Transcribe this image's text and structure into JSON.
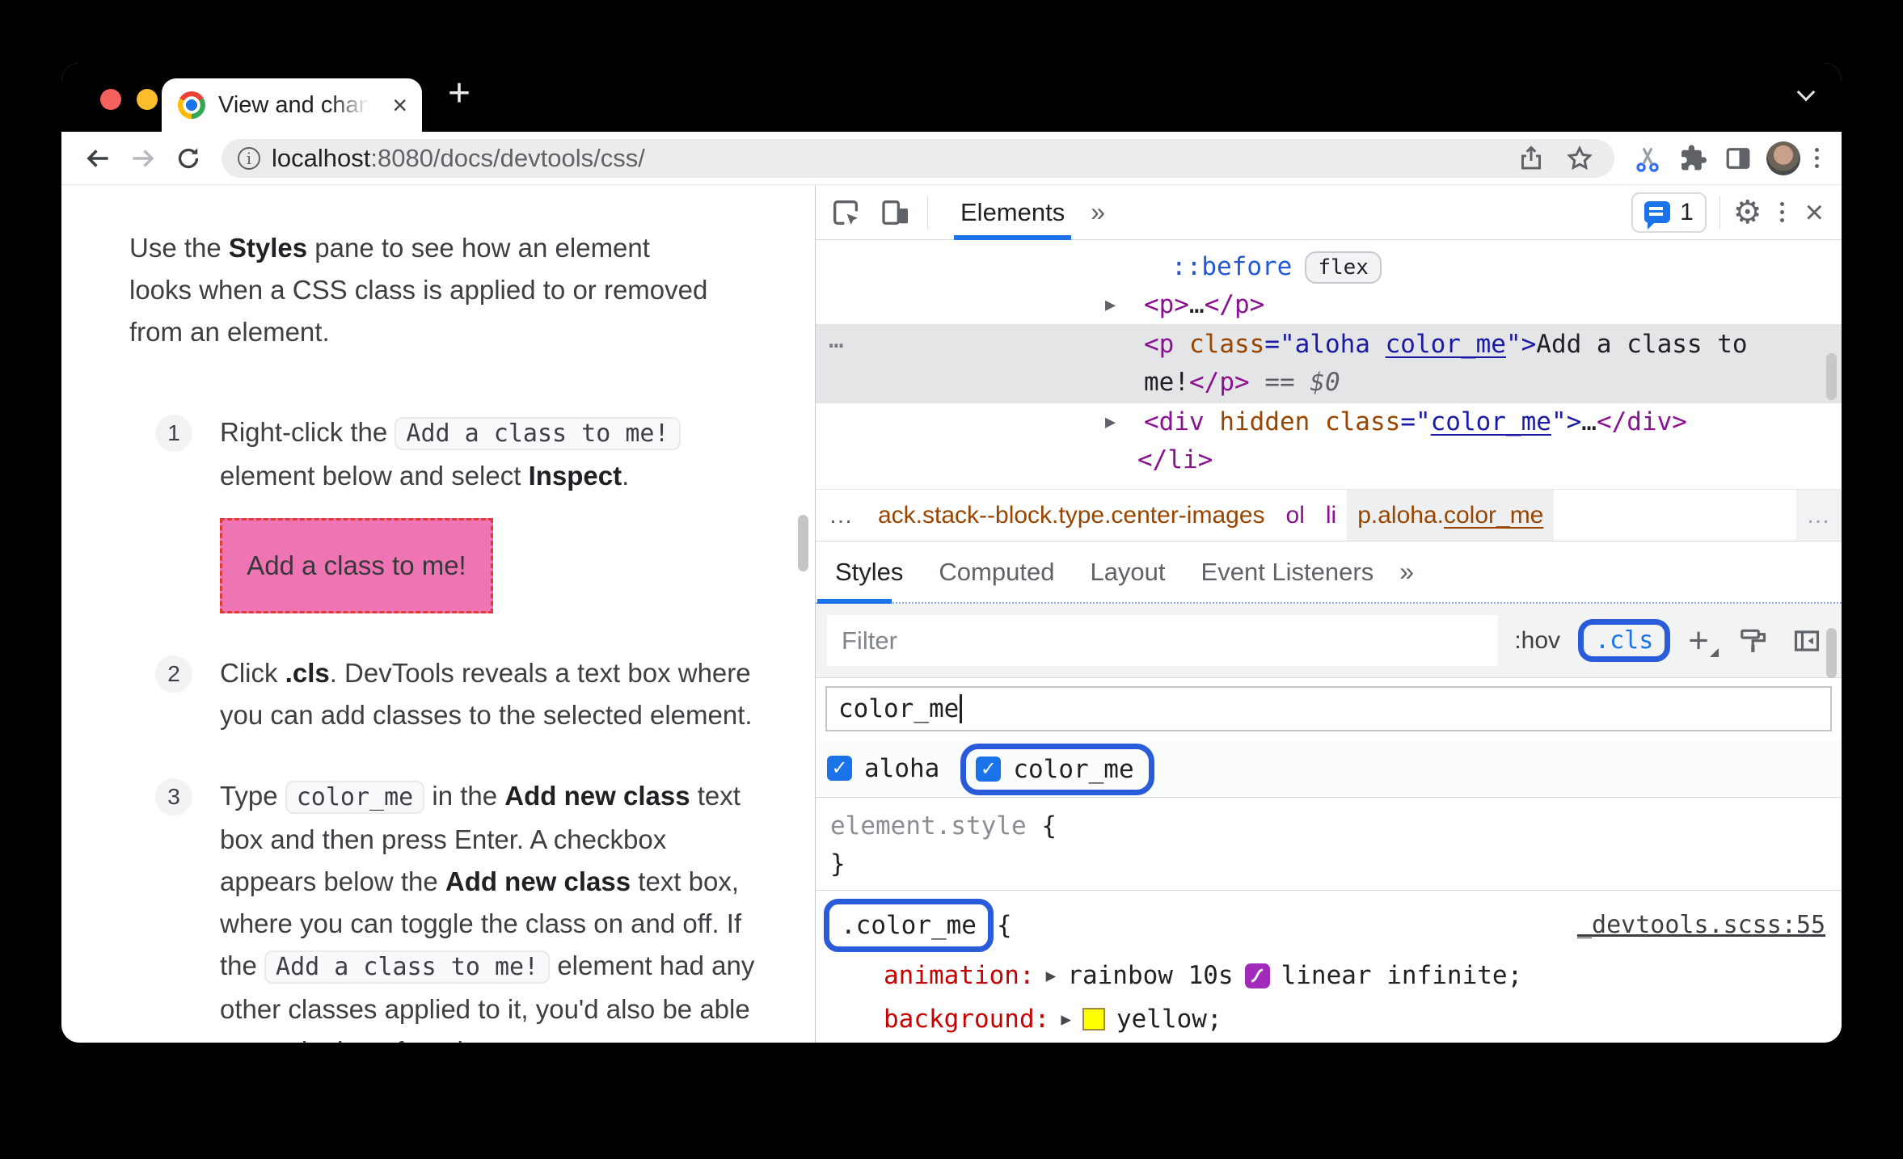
{
  "browser": {
    "tab": {
      "title": "View and change CSS - Chrome",
      "close": "×"
    },
    "new_tab": "+",
    "toolbar": {
      "url_host": "localhost",
      "url_path": ":8080/docs/devtools/css/"
    }
  },
  "doc": {
    "intro": {
      "a": "Use the ",
      "bold": "Styles",
      "b": " pane to see how an element looks when a CSS class is applied to or removed from an element."
    },
    "step1": {
      "num": "1",
      "a": "Right-click the ",
      "code": "Add a class to me!",
      "b": " element below and select ",
      "bold": "Inspect",
      "c": "."
    },
    "demo_box_text": "Add a class to me!",
    "step2": {
      "num": "2",
      "a": "Click ",
      "bold": ".cls",
      "b": ". DevTools reveals a text box where you can add classes to the selected element."
    },
    "step3": {
      "num": "3",
      "a": "Type ",
      "code": "color_me",
      "b": " in the ",
      "bold1": "Add new class",
      "c": " text box and then press Enter. A checkbox appears below the ",
      "bold2": "Add new class",
      "d": " text box, where you can toggle the class on and off. If the ",
      "code2": "Add a class to me!",
      "e": " element had any other classes applied to it, you'd also be able to toggle them from here."
    }
  },
  "devtools": {
    "toolbar": {
      "tab": "Elements",
      "more": "»",
      "issues_count": "1",
      "close": "×",
      "gear": "⚙"
    },
    "dom": {
      "pseudo": "::before",
      "flex_badge": "flex",
      "arrow": "▶",
      "p_row": {
        "open": "<p>",
        "dots": "…",
        "close": "</p>"
      },
      "selected_row": {
        "marker": "…",
        "tag_open": "<p ",
        "attr_name": "class",
        "eq": "=\"",
        "val_a": "aloha ",
        "val_b": "color_me",
        "close_quote": "\">",
        "text": "Add a class to me!",
        "tag_close": "</p>",
        "equals": " == ",
        "last_selected": "$0"
      },
      "div_row": {
        "tag_open": "<div ",
        "attr1": "hidden ",
        "attr2": "class",
        "eq": "=\"",
        "val": "color_me",
        "close_quote": "\">",
        "dots": "…",
        "tag_close": "</div>"
      },
      "li_close": "</li>"
    },
    "breadcrumbs": {
      "overflow_left": "…",
      "crumb_stack": "ack.stack--block.type.center-images",
      "crumb_ol": "ol",
      "crumb_li": "li",
      "crumb_p_a": "p.aloha.",
      "crumb_p_b": "color_me",
      "overflow_right": "…"
    },
    "styles_pane": {
      "tabs": [
        "Styles",
        "Computed",
        "Layout",
        "Event Listeners"
      ],
      "tabs_more": "»",
      "filter_placeholder": "Filter",
      "hov_toggle": ":hov",
      "cls_toggle": ".cls",
      "new_class_value": "color_me",
      "checkboxes": [
        {
          "label": "aloha",
          "check": "✓"
        },
        {
          "label": "color_me",
          "check": "✓"
        }
      ],
      "element_style": {
        "selector": "element.style",
        "open": "{",
        "close": "}"
      },
      "rule": {
        "selector": ".color_me",
        "open": "{",
        "source_link": "_devtools.scss:55",
        "prop1": {
          "name": "animation:",
          "arrow": "▶",
          "value_a": "rainbow 10s",
          "value_b": "linear infinite;"
        },
        "prop2": {
          "name": "background:",
          "arrow": "▶",
          "value": "yellow;"
        },
        "close": "}"
      }
    }
  },
  "colors": {
    "annotation_blue": "#2a5bd8",
    "checkbox_blue": "#1a73e8",
    "demo_box_pink": "#ee74b4",
    "demo_box_border": "#e33a35",
    "swatch_yellow": "#ffff00"
  }
}
